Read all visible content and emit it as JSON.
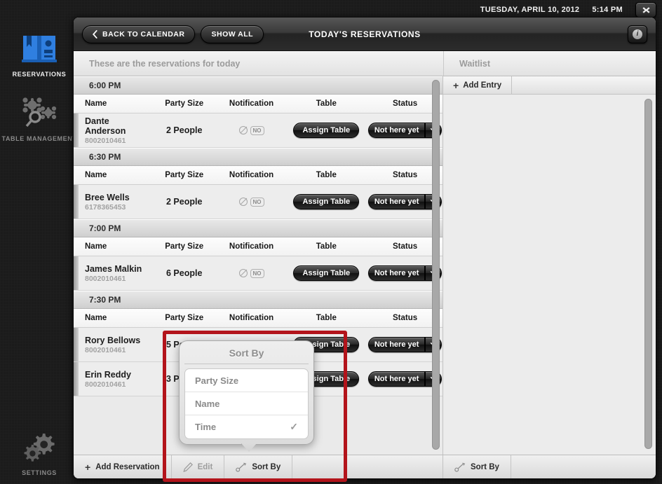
{
  "statusbar": {
    "date": "TUESDAY, APRIL 10, 2012",
    "time": "5:14 PM",
    "close_label": "✖"
  },
  "rail": {
    "items": [
      {
        "label": "RESERVATIONS",
        "icon": "book-contacts-icon",
        "active": true
      },
      {
        "label": "TABLE MANAGEMENT",
        "icon": "tables-icon",
        "active": false
      },
      {
        "label": "SETTINGS",
        "icon": "gears-icon",
        "active": false
      }
    ]
  },
  "titlebar": {
    "back_label": "BACK TO CALENDAR",
    "show_all_label": "SHOW ALL",
    "title": "TODAY'S RESERVATIONS",
    "info_label": "i"
  },
  "subheader": {
    "left": "These are the reservations for today",
    "right": "Waitlist"
  },
  "columns": {
    "name": "Name",
    "party": "Party Size",
    "notification": "Notification",
    "table": "Table",
    "status": "Status"
  },
  "buttons": {
    "assign_table": "Assign Table",
    "status_label": "Not here yet",
    "caret": "❯"
  },
  "notification": {
    "badge": "NO"
  },
  "groups": [
    {
      "time": "6:00 PM",
      "rows": [
        {
          "name": "Dante Anderson",
          "phone": "8002010461",
          "party": "2 People"
        }
      ]
    },
    {
      "time": "6:30 PM",
      "rows": [
        {
          "name": "Bree Wells",
          "phone": "6178365453",
          "party": "2 People"
        }
      ]
    },
    {
      "time": "7:00 PM",
      "rows": [
        {
          "name": "James Malkin",
          "phone": "8002010461",
          "party": "6 People"
        }
      ]
    },
    {
      "time": "7:30 PM",
      "rows": [
        {
          "name": "Rory Bellows",
          "phone": "8002010461",
          "party": "5 People"
        },
        {
          "name": "Erin Reddy",
          "phone": "8002010461",
          "party": "3 People"
        }
      ]
    }
  ],
  "waitlist": {
    "add_entry": "Add Entry",
    "plus": "+"
  },
  "bottombar": {
    "add_reservation": "Add Reservation",
    "edit": "Edit",
    "sort_by": "Sort By",
    "waitlist_sort_by": "Sort By",
    "plus": "+"
  },
  "popover": {
    "title": "Sort By",
    "options": [
      {
        "label": "Party Size",
        "checked": false
      },
      {
        "label": "Name",
        "checked": false
      },
      {
        "label": "Time",
        "checked": true
      }
    ],
    "check_glyph": "✓"
  },
  "colors": {
    "accent_blue": "#2f7fe0",
    "annotation_red": "#b3141b",
    "window_bg": "#ececec",
    "rail_bg": "#1b1b1b"
  }
}
